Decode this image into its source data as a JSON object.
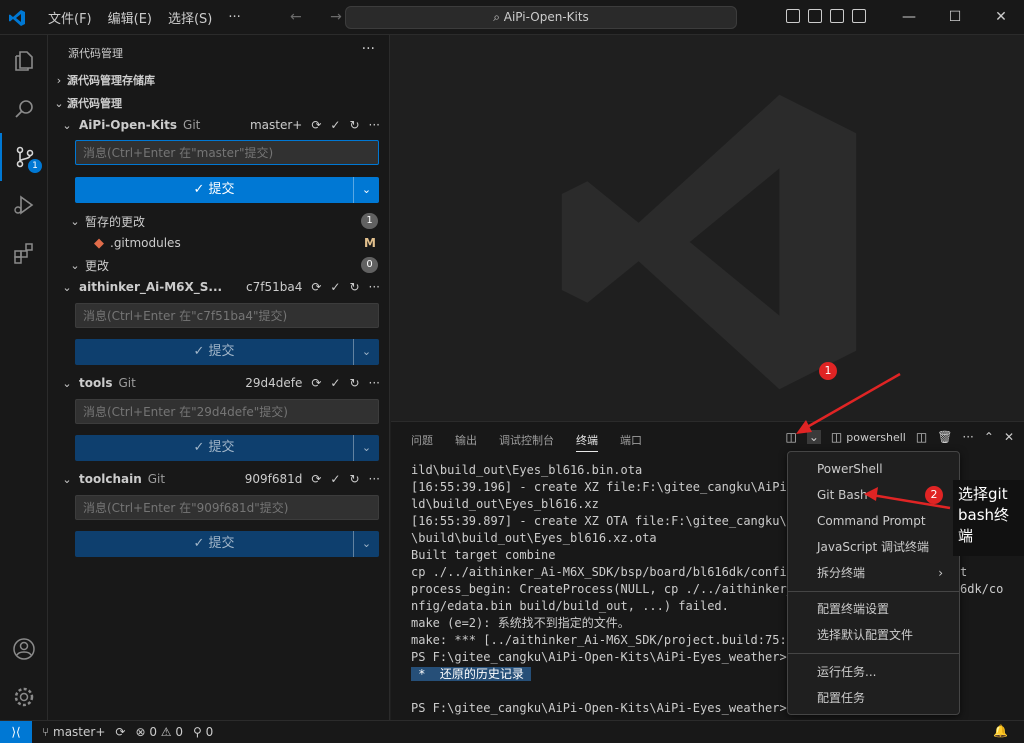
{
  "titlebar": {
    "menu": [
      "文件(F)",
      "编辑(E)",
      "选择(S)",
      "···"
    ],
    "nav_arrows": "← →",
    "search_text": "⌕ AiPi-Open-Kits",
    "controls": [
      "—",
      "☐",
      "✕"
    ]
  },
  "activity": {
    "scm_badge": "1"
  },
  "sidebar": {
    "title": "源代码管理",
    "repos_section": "源代码管理存储库",
    "scm_section": "源代码管理",
    "repos": [
      {
        "name": "AiPi-Open-Kits",
        "vcs": "Git",
        "branch": "master+",
        "placeholder": "消息(Ctrl+Enter 在\"master\"提交)",
        "commit_label": "✓ 提交",
        "staged_label": "暂存的更改",
        "staged_count": "1",
        "file_name": ".gitmodules",
        "file_status": "M",
        "changes_label": "更改",
        "changes_count": "0"
      },
      {
        "name": "aithinker_Ai-M6X_S...",
        "vcs": "",
        "branch": "c7f51ba4",
        "placeholder": "消息(Ctrl+Enter 在\"c7f51ba4\"提交)",
        "commit_label": "✓ 提交"
      },
      {
        "name": "tools",
        "vcs": "Git",
        "branch": "29d4defe",
        "placeholder": "消息(Ctrl+Enter 在\"29d4defe\"提交)",
        "commit_label": "✓ 提交"
      },
      {
        "name": "toolchain",
        "vcs": "Git",
        "branch": "909f681d",
        "placeholder": "消息(Ctrl+Enter 在\"909f681d\"提交)",
        "commit_label": "✓ 提交"
      }
    ]
  },
  "panel": {
    "tabs": [
      "问题",
      "输出",
      "调试控制台",
      "终端",
      "端口"
    ],
    "terminal_name": "powershell",
    "lines": [
      "ild\\build_out\\Eyes_bl616.bin.ota",
      "[16:55:39.196] - create XZ file:F:\\gitee_cangku\\AiPi-O",
      "ld\\build_out\\Eyes_bl616.xz",
      "[16:55:39.897] - create XZ OTA file:F:\\gitee_cangku\\Ai",
      "\\build\\build_out\\Eyes_bl616.xz.ota",
      "Built target combine",
      "cp ./../aithinker_Ai-M6X_SDK/bsp/board/bl616dk/config/",
      "process_begin: CreateProcess(NULL, cp ./../aithinker_A",
      "nfig/edata.bin build/build_out, ...) failed.",
      "make (e=2): 系统找不到指定的文件。",
      "make: *** [../aithinker_Ai-M6X_SDK/project.build:75: b",
      "PS F:\\gitee_cangku\\AiPi-Open-Kits\\AiPi-Eyes_weather>"
    ],
    "history_marker": " *  还原的历史记录 ",
    "last_prompt": "PS F:\\gitee_cangku\\AiPi-Open-Kits\\AiPi-Eyes_weather>",
    "right_fragments": [
      "t",
      "6dk/co"
    ]
  },
  "dropdown": {
    "group1": [
      "PowerShell",
      "Git Bash",
      "Command Prompt",
      "JavaScript 调试终端",
      "拆分终端"
    ],
    "group2": [
      "配置终端设置",
      "选择默认配置文件"
    ],
    "group3": [
      "运行任务...",
      "配置任务"
    ],
    "submenu_arrow": "›"
  },
  "annotations": {
    "num1": "1",
    "num2": "2",
    "note": "选择git bash终端",
    "color": "#e02424"
  },
  "statusbar": {
    "remote": "⟩⟨",
    "branch": "⑂ master+",
    "sync": "⟳",
    "problems": "⊗ 0 ⚠ 0",
    "ports": "⚲ 0",
    "bell": "🔔"
  }
}
